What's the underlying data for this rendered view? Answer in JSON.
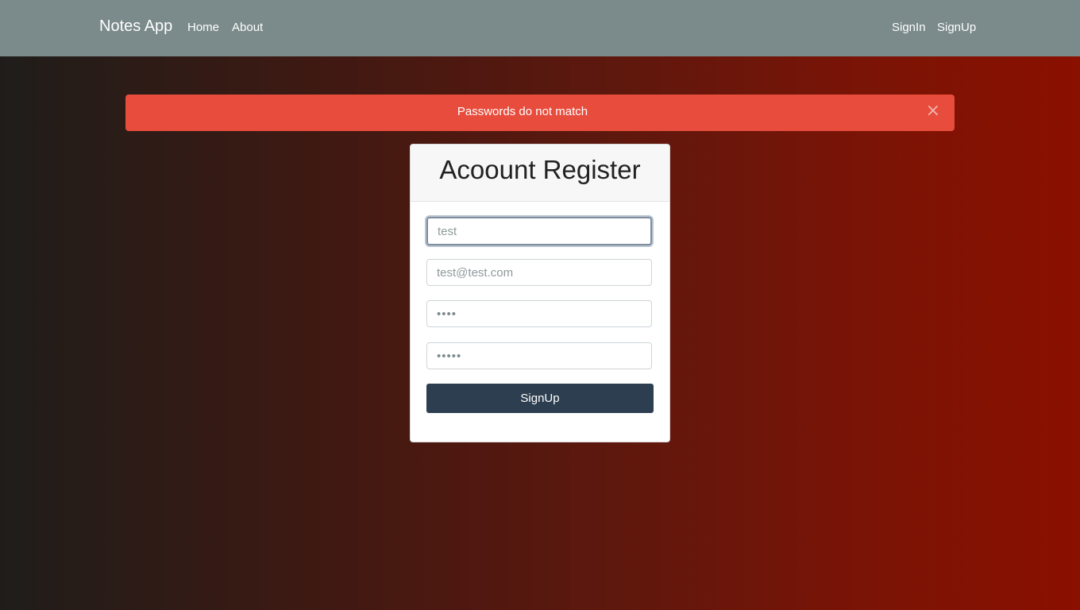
{
  "navbar": {
    "brand": "Notes App",
    "links": [
      {
        "label": "Home"
      },
      {
        "label": "About"
      }
    ],
    "auth_links": [
      {
        "label": "SignIn"
      },
      {
        "label": "SignUp"
      }
    ],
    "background_color": "#7b8a8b"
  },
  "alert": {
    "message": "Passwords do not match",
    "close_label": "×",
    "color": "#e74c3c"
  },
  "register_form": {
    "title": "Acoount Register",
    "username": {
      "value": "",
      "placeholder": "test"
    },
    "email": {
      "value": "",
      "placeholder": "test@test.com"
    },
    "password": {
      "value": "abcd"
    },
    "confirm_password": {
      "value": "abcde"
    },
    "submit_label": "SignUp",
    "submit_color": "#2c3e50"
  }
}
